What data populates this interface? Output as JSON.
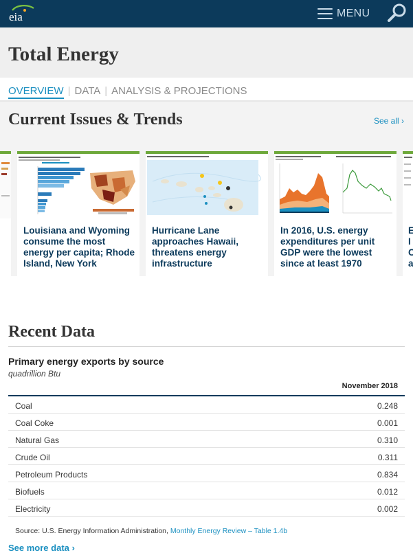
{
  "header": {
    "logo_text": "eia",
    "menu_label": "MENU"
  },
  "page": {
    "title": "Total Energy"
  },
  "tabs": [
    {
      "label": "OVERVIEW",
      "active": true
    },
    {
      "label": "DATA",
      "active": false
    },
    {
      "label": "ANALYSIS & PROJECTIONS",
      "active": false
    }
  ],
  "issues": {
    "title": "Current Issues & Trends",
    "see_all_label": "See all ›",
    "cards": [
      {
        "headline": "Louisiana and Wyoming consume the most energy per capita; Rhode Island, New York",
        "thumb": "us-energy-per-capita-map"
      },
      {
        "headline": "Hurricane Lane approaches Hawaii, threatens energy infrastructure",
        "thumb": "hawaii-infrastructure-map"
      },
      {
        "headline": "In 2016, U.S. energy expenditures per unit GDP were the lowest since at least 1970",
        "thumb": "energy-expenditures-chart"
      }
    ],
    "partial_right_lines": [
      "E",
      "I",
      "C",
      "a"
    ]
  },
  "recent_data": {
    "title": "Recent Data",
    "table_title": "Primary energy exports by source",
    "units": "quadrillion Btu",
    "column_header": "November 2018",
    "rows": [
      {
        "name": "Coal",
        "value": "0.248"
      },
      {
        "name": "Coal Coke",
        "value": "0.001"
      },
      {
        "name": "Natural Gas",
        "value": "0.310"
      },
      {
        "name": "Crude Oil",
        "value": "0.311"
      },
      {
        "name": "Petroleum Products",
        "value": "0.834"
      },
      {
        "name": "Biofuels",
        "value": "0.012"
      },
      {
        "name": "Electricity",
        "value": "0.002"
      }
    ],
    "source_prefix": "Source: U.S. Energy Information Administration, ",
    "source_link": "Monthly Energy Review – Table 1.4b",
    "see_more_label": "See more data ›"
  },
  "colors": {
    "header_bg": "#0c3a5b",
    "accent_link": "#1a8fc0",
    "card_border": "#6da83a"
  }
}
